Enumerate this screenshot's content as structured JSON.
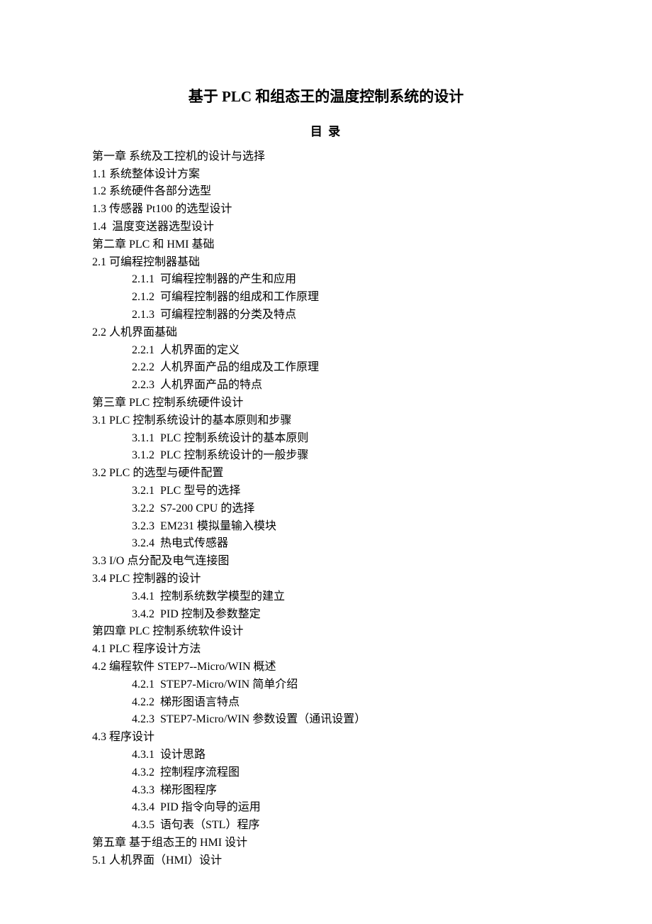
{
  "title": "基于 PLC 和组态王的温度控制系统的设计",
  "toc_label": "目 录",
  "lines": [
    {
      "indent": 1,
      "text": "第一章 系统及工控机的设计与选择"
    },
    {
      "indent": 1,
      "text": "1.1 系统整体设计方案"
    },
    {
      "indent": 1,
      "text": "1.2 系统硬件各部分选型"
    },
    {
      "indent": 1,
      "text": "1.3 传感器 Pt100 的选型设计"
    },
    {
      "indent": 1,
      "text": "1.4  温度变送器选型设计"
    },
    {
      "indent": 1,
      "text": "第二章 PLC 和 HMI 基础"
    },
    {
      "indent": 1,
      "text": "2.1 可编程控制器基础"
    },
    {
      "indent": 2,
      "text": "2.1.1  可编程控制器的产生和应用"
    },
    {
      "indent": 2,
      "text": "2.1.2  可编程控制器的组成和工作原理"
    },
    {
      "indent": 2,
      "text": "2.1.3  可编程控制器的分类及特点"
    },
    {
      "indent": 1,
      "text": "2.2 人机界面基础"
    },
    {
      "indent": 2,
      "text": "2.2.1  人机界面的定义"
    },
    {
      "indent": 2,
      "text": "2.2.2  人机界面产品的组成及工作原理"
    },
    {
      "indent": 2,
      "text": "2.2.3  人机界面产品的特点"
    },
    {
      "indent": 1,
      "text": "第三章 PLC 控制系统硬件设计"
    },
    {
      "indent": 1,
      "text": "3.1 PLC 控制系统设计的基本原则和步骤"
    },
    {
      "indent": 2,
      "text": "3.1.1  PLC 控制系统设计的基本原则"
    },
    {
      "indent": 2,
      "text": "3.1.2  PLC 控制系统设计的一般步骤"
    },
    {
      "indent": 1,
      "text": "3.2 PLC 的选型与硬件配置"
    },
    {
      "indent": 2,
      "text": "3.2.1  PLC 型号的选择"
    },
    {
      "indent": 2,
      "text": "3.2.2  S7-200 CPU 的选择"
    },
    {
      "indent": 2,
      "text": "3.2.3  EM231 模拟量输入模块"
    },
    {
      "indent": 2,
      "text": "3.2.4  热电式传感器"
    },
    {
      "indent": 1,
      "text": "3.3 I/O 点分配及电气连接图"
    },
    {
      "indent": 1,
      "text": "3.4 PLC 控制器的设计"
    },
    {
      "indent": 2,
      "text": "3.4.1  控制系统数学模型的建立"
    },
    {
      "indent": 2,
      "text": "3.4.2  PID 控制及参数整定"
    },
    {
      "indent": 1,
      "text": "第四章 PLC 控制系统软件设计"
    },
    {
      "indent": 1,
      "text": "4.1 PLC 程序设计方法"
    },
    {
      "indent": 1,
      "text": "4.2 编程软件 STEP7--Micro/WIN 概述"
    },
    {
      "indent": 2,
      "text": "4.2.1  STEP7-Micro/WIN 简单介绍"
    },
    {
      "indent": 2,
      "text": "4.2.2  梯形图语言特点"
    },
    {
      "indent": 2,
      "text": "4.2.3  STEP7-Micro/WIN 参数设置（通讯设置）"
    },
    {
      "indent": 1,
      "text": "4.3 程序设计"
    },
    {
      "indent": 2,
      "text": "4.3.1  设计思路"
    },
    {
      "indent": 2,
      "text": "4.3.2  控制程序流程图"
    },
    {
      "indent": 2,
      "text": "4.3.3  梯形图程序"
    },
    {
      "indent": 2,
      "text": "4.3.4  PID 指令向导的运用"
    },
    {
      "indent": 2,
      "text": "4.3.5  语句表（STL）程序"
    },
    {
      "indent": 1,
      "text": "第五章 基于组态王的 HMI 设计"
    },
    {
      "indent": 1,
      "text": "5.1 人机界面（HMI）设计"
    }
  ]
}
